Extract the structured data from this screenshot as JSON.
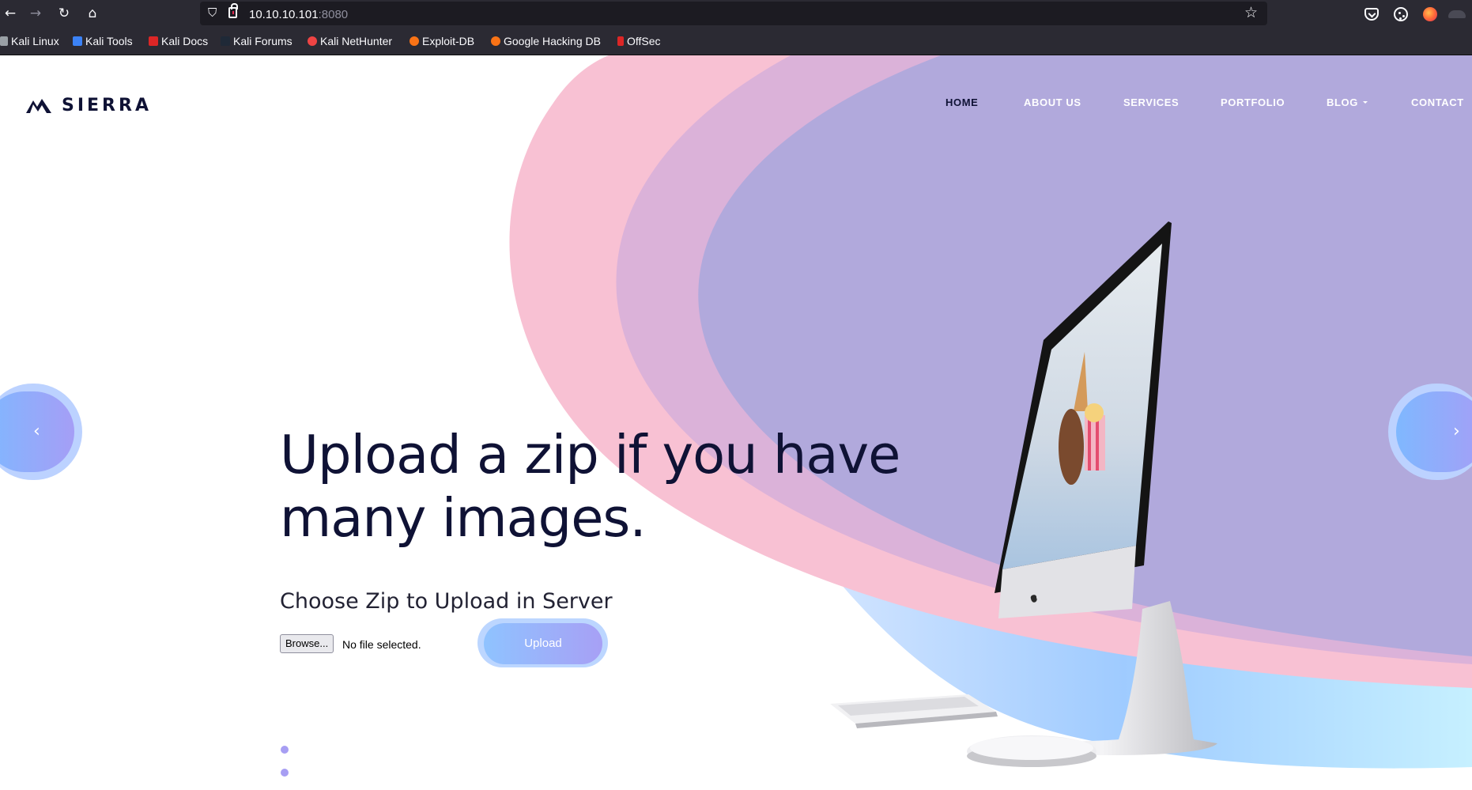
{
  "browser": {
    "url_host": "10.10.10.101",
    "url_port": ":8080",
    "bookmarks": [
      {
        "label": "Kali Linux",
        "icon": "kali-dragon-icon"
      },
      {
        "label": "Kali Tools",
        "icon": "kali-tools-icon"
      },
      {
        "label": "Kali Docs",
        "icon": "kali-docs-icon"
      },
      {
        "label": "Kali Forums",
        "icon": "kali-forums-icon"
      },
      {
        "label": "Kali NetHunter",
        "icon": "nethunter-icon"
      },
      {
        "label": "Exploit-DB",
        "icon": "exploit-db-icon"
      },
      {
        "label": "Google Hacking DB",
        "icon": "ghdb-icon"
      },
      {
        "label": "OffSec",
        "icon": "offsec-icon"
      }
    ]
  },
  "site": {
    "logo_text": "SIERRA",
    "nav": [
      "HOME",
      "ABOUT US",
      "SERVICES",
      "PORTFOLIO",
      "BLOG",
      "CONTACT"
    ],
    "active_nav": "HOME"
  },
  "hero": {
    "headline_line1": "Upload a zip if you have",
    "headline_line2": "many images.",
    "subhead": "Choose Zip to Upload in Server",
    "browse_label": "Browse...",
    "file_status": "No file selected.",
    "upload_label": "Upload",
    "arrow_prev": "‹",
    "arrow_next": "›"
  },
  "colors": {
    "navy": "#0f1235",
    "pink": "#f8c1d3",
    "lavender": "#b1a9dc",
    "sky_blue": "#8fc3ff",
    "chrome_dark": "#2b2a33"
  }
}
